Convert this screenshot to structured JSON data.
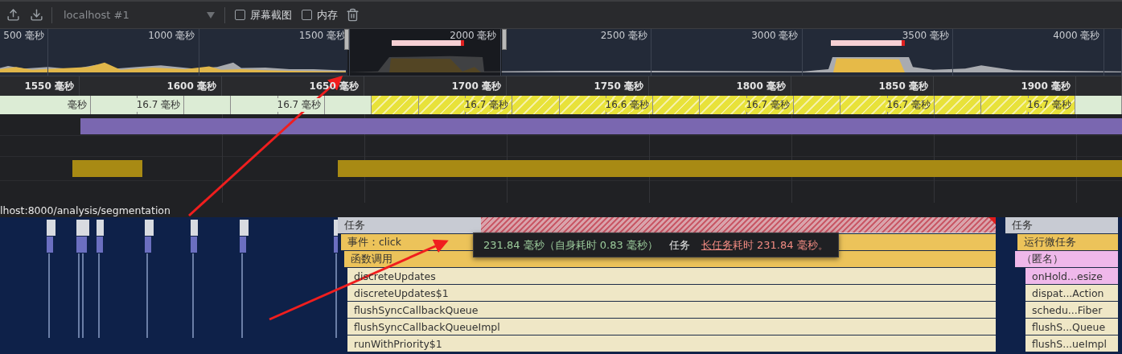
{
  "toolbar": {
    "profile_select": {
      "value": "localhost #1"
    },
    "checkboxes": [
      {
        "label": "屏幕截图",
        "checked": false
      },
      {
        "label": "内存",
        "checked": false
      }
    ]
  },
  "overview": {
    "ticks": [
      "500 毫秒",
      "1000 毫秒",
      "1500 毫秒",
      "2000 毫秒",
      "2500 毫秒",
      "3000 毫秒",
      "3500 毫秒",
      "4000 毫秒"
    ]
  },
  "ruler": {
    "ticks": [
      "1550 毫秒",
      "1600 毫秒",
      "1650 毫秒",
      "1700 毫秒",
      "1750 毫秒",
      "1800 毫秒",
      "1850 毫秒",
      "1900 毫秒"
    ]
  },
  "frames": [
    {
      "kind": "idle",
      "label": "毫秒"
    },
    {
      "kind": "idle"
    },
    {
      "kind": "idle",
      "label": "16.7 毫秒"
    },
    {
      "kind": "idle"
    },
    {
      "kind": "idle"
    },
    {
      "kind": "idle",
      "label": "16.7 毫秒"
    },
    {
      "kind": "idle"
    },
    {
      "kind": "partial"
    },
    {
      "kind": "partial"
    },
    {
      "kind": "partial",
      "label": "16.7 毫秒"
    },
    {
      "kind": "partial"
    },
    {
      "kind": "partial"
    },
    {
      "kind": "partial",
      "label": "16.6 毫秒"
    },
    {
      "kind": "partial"
    },
    {
      "kind": "partial"
    },
    {
      "kind": "partial",
      "label": "16.7 毫秒"
    },
    {
      "kind": "partial"
    },
    {
      "kind": "partial"
    },
    {
      "kind": "partial",
      "label": "16.7 毫秒"
    },
    {
      "kind": "partial"
    },
    {
      "kind": "partial"
    },
    {
      "kind": "partial",
      "label": "16.7 毫秒"
    },
    {
      "kind": "idle"
    }
  ],
  "main_thread": {
    "url": "lhost:8000/analysis/segmentation"
  },
  "flame_main": [
    {
      "label": "任务",
      "kind": "task",
      "long_task": true
    },
    {
      "label": "事件：click",
      "kind": "event"
    },
    {
      "label": "函数调用",
      "kind": "event"
    },
    {
      "label": "discreteUpdates",
      "kind": "call"
    },
    {
      "label": "discreteUpdates$1",
      "kind": "call"
    },
    {
      "label": "flushSyncCallbackQueue",
      "kind": "call"
    },
    {
      "label": "flushSyncCallbackQueueImpl",
      "kind": "call"
    },
    {
      "label": "runWithPriority$1",
      "kind": "call"
    }
  ],
  "flame_side": [
    {
      "label": "任务",
      "kind": "task"
    },
    {
      "label": "运行微任务",
      "kind": "event"
    },
    {
      "label": "（匿名）",
      "kind": "script"
    },
    {
      "label": "onHold...esize",
      "kind": "script"
    },
    {
      "label": "dispat...Action",
      "kind": "call"
    },
    {
      "label": "schedu...Fiber",
      "kind": "call"
    },
    {
      "label": "flushS...Queue",
      "kind": "call"
    },
    {
      "label": "flushS...ueImpl",
      "kind": "call"
    }
  ],
  "tooltip": {
    "duration": "231.84 毫秒（自身耗时 0.83 毫秒）",
    "category": "任务",
    "warning_link": "长任务",
    "warning_rest": "耗时 231.84 毫秒。"
  }
}
